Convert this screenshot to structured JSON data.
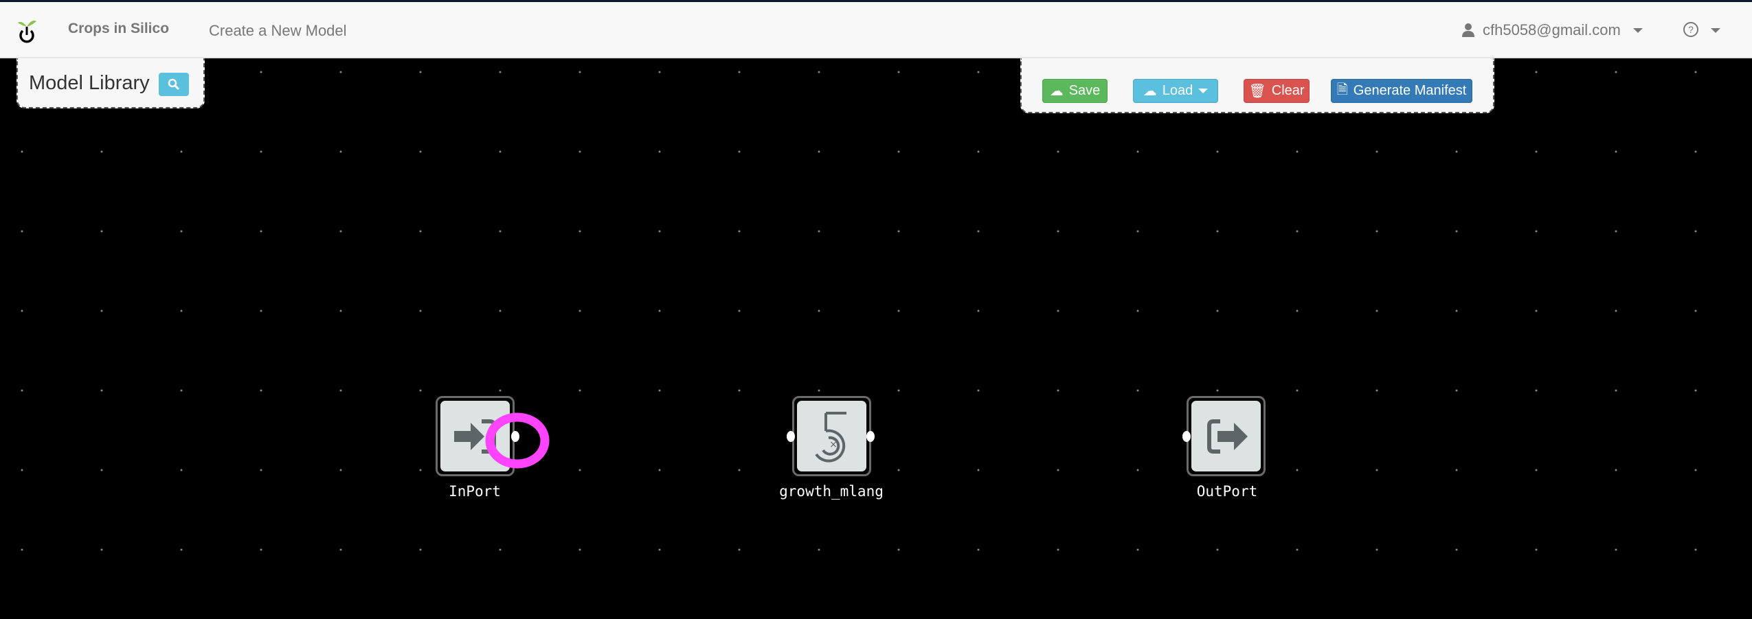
{
  "navbar": {
    "brand": "Crops in Silico",
    "links": [
      {
        "label": "Create a New Model"
      }
    ],
    "user_email": "cfh5058@gmail.com",
    "icons": [
      "sprout-power-logo",
      "user-icon",
      "help-circle-icon"
    ]
  },
  "model_library": {
    "title": "Model Library",
    "search_icon": "search-icon"
  },
  "toolbar": {
    "save": "Save",
    "load": "Load",
    "clear": "Clear",
    "generate": "Generate Manifest"
  },
  "colors": {
    "save": "#5cb85c",
    "load": "#5bc0de",
    "clear": "#d9534f",
    "generate": "#337ab7",
    "highlight": "#ff44ff"
  },
  "nodes": [
    {
      "label": "InPort",
      "icon": "sign-in-icon"
    },
    {
      "label": "growth_mlang",
      "icon": "spiral-5-icon"
    },
    {
      "label": "OutPort",
      "icon": "sign-out-icon"
    }
  ]
}
